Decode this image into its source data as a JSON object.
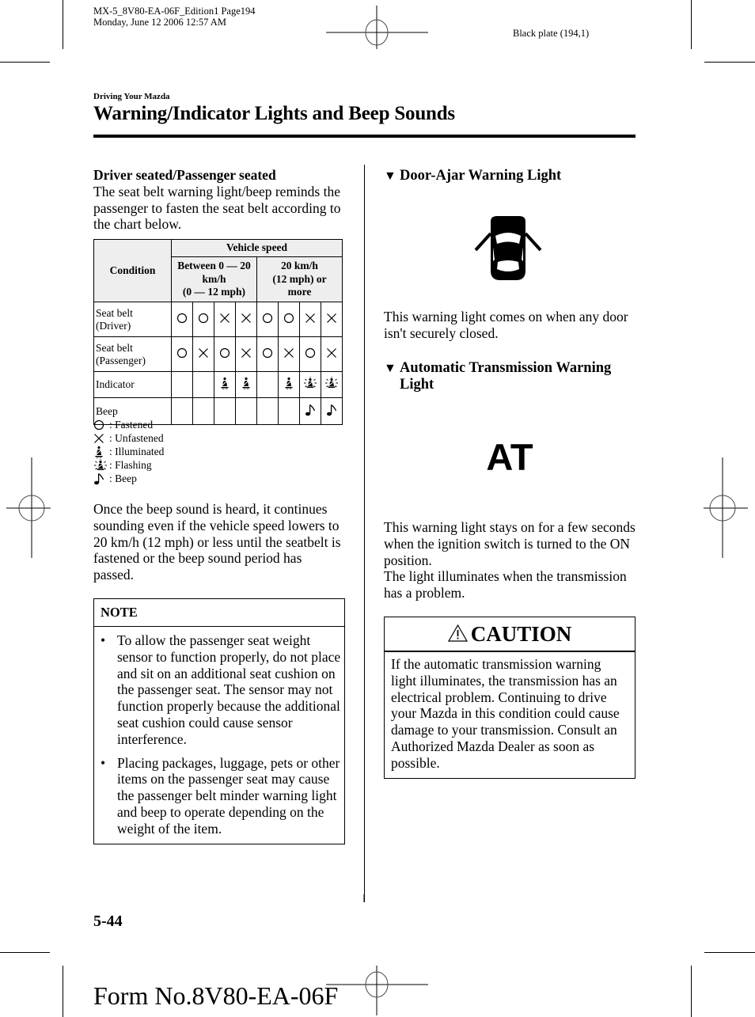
{
  "print_meta": {
    "job_line": "MX-5_8V80-EA-06F_Edition1 Page194",
    "date_line": "Monday, June 12 2006 12:57 AM",
    "plate": "Black plate (194,1)"
  },
  "header": {
    "section": "Driving Your Mazda",
    "title": "Warning/Indicator Lights and Beep Sounds"
  },
  "left": {
    "subheading": "Driver seated/Passenger seated",
    "intro": "The seat belt warning light/beep reminds the passenger to fasten the seat belt according to the chart below.",
    "table": {
      "condition_header": "Condition",
      "speed_header": "Vehicle speed",
      "speed_low": [
        "Between 0 — 20",
        "km/h",
        "(0 — 12 mph)"
      ],
      "speed_high": [
        "20 km/h",
        "(12 mph) or",
        "more"
      ],
      "rows": [
        {
          "label": [
            "Seat belt",
            "(Driver)"
          ],
          "cells": [
            "fastened",
            "fastened",
            "unfastened",
            "unfastened",
            "fastened",
            "fastened",
            "unfastened",
            "unfastened"
          ]
        },
        {
          "label": [
            "Seat belt",
            "(Passenger)"
          ],
          "cells": [
            "fastened",
            "unfastened",
            "fastened",
            "unfastened",
            "fastened",
            "unfastened",
            "fastened",
            "unfastened"
          ]
        },
        {
          "label": [
            "Indicator"
          ],
          "cells": [
            "",
            "",
            "illuminated",
            "illuminated",
            "",
            "illuminated",
            "flashing",
            "flashing"
          ]
        },
        {
          "label": [
            "Beep"
          ],
          "cells": [
            "",
            "",
            "",
            "",
            "",
            "",
            "beep",
            "beep"
          ]
        }
      ]
    },
    "legend": [
      {
        "symbol": "fastened",
        "label": ": Fastened"
      },
      {
        "symbol": "unfastened",
        "label": ": Unfastened"
      },
      {
        "symbol": "illuminated",
        "label": ": Illuminated"
      },
      {
        "symbol": "flashing",
        "label": ": Flashing"
      },
      {
        "symbol": "beep",
        "label": ": Beep"
      }
    ],
    "after_text": "Once the beep sound is heard, it continues sounding even if the vehicle speed lowers to 20 km/h (12 mph) or less until the seatbelt is fastened or the beep sound period has passed.",
    "note": {
      "title": "NOTE",
      "bullets": [
        "To allow the passenger seat weight sensor to function properly, do not place and sit on an additional seat cushion on the passenger seat. The sensor may not function properly because the additional seat cushion could cause sensor interference.",
        "Placing packages, luggage, pets or other items on the passenger seat may cause the passenger belt minder warning light and beep to operate depending on the weight of the item."
      ]
    }
  },
  "right": {
    "door_ajar": {
      "heading": "Door-Ajar Warning Light",
      "text": "This warning light comes on when any door isn't securely closed."
    },
    "at_warning": {
      "heading": "Automatic Transmission Warning Light",
      "symbol_text": "AT",
      "text_1": "This warning light stays on for a few seconds when the ignition switch is turned to the ON position.",
      "text_2": "The light illuminates when the transmission has a problem."
    },
    "caution": {
      "title": "CAUTION",
      "text": "If the automatic transmission warning light illuminates, the transmission has an electrical problem. Continuing to drive your Mazda in this condition could cause damage to your transmission. Consult an Authorized Mazda Dealer as soon as possible."
    }
  },
  "footer": {
    "page_number": "5-44",
    "form_number": "Form No.8V80-EA-06F"
  }
}
